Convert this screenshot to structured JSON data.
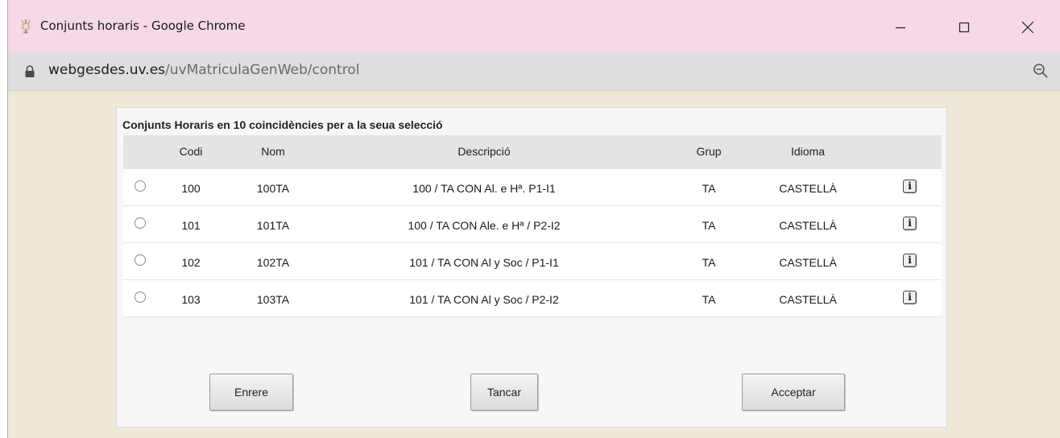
{
  "window": {
    "title": "Conjunts horaris - Google Chrome",
    "url_host": "webgesdes.uv.es",
    "url_path": "/uvMatriculaGenWeb/control"
  },
  "panel": {
    "title": "Conjunts Horaris en 10 coincidències per a la seua selecció",
    "columns": {
      "codi": "Codi",
      "nom": "Nom",
      "descripcio": "Descripció",
      "grup": "Grup",
      "idioma": "Idioma"
    },
    "rows": [
      {
        "codi": "100",
        "nom": "100TA",
        "descripcio": "100 / TA CON Al. e Hª. P1-I1",
        "grup": "TA",
        "idioma": "CASTELLÀ"
      },
      {
        "codi": "101",
        "nom": "101TA",
        "descripcio": "100 / TA CON Ale. e Hª / P2-I2",
        "grup": "TA",
        "idioma": "CASTELLÀ"
      },
      {
        "codi": "102",
        "nom": "102TA",
        "descripcio": "101 / TA CON Al y Soc / P1-I1",
        "grup": "TA",
        "idioma": "CASTELLÀ"
      },
      {
        "codi": "103",
        "nom": "103TA",
        "descripcio": "101 / TA CON Al y Soc / P2-I2",
        "grup": "TA",
        "idioma": "CASTELLÀ"
      }
    ],
    "info_glyph": "i",
    "buttons": {
      "back": "Enrere",
      "close": "Tancar",
      "accept": "Acceptar"
    }
  },
  "icons": {
    "app": "app-icon",
    "lock": "lock-icon",
    "zoom": "zoom-out-icon",
    "minimize": "minimize-icon",
    "maximize": "maximize-icon",
    "close": "close-icon",
    "radio": "radio-button",
    "info": "info-icon"
  },
  "colors": {
    "titlebar": "#f5d9e6",
    "urlbar": "#dedede",
    "page_bg": "#ede8d8",
    "header_row": "#e4e4e4"
  }
}
